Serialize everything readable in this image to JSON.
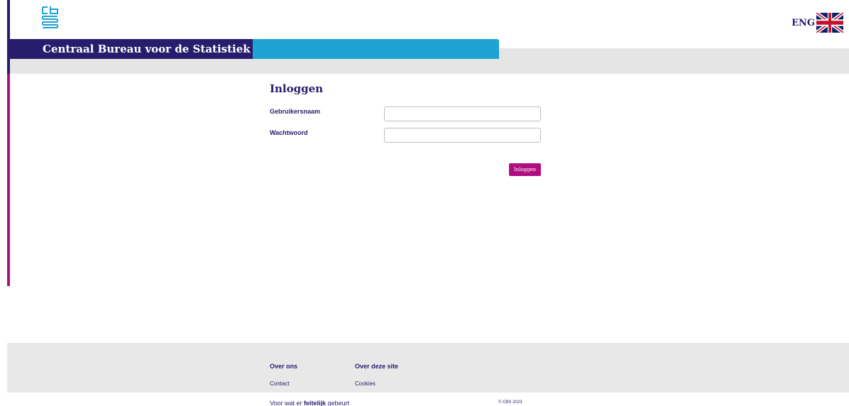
{
  "header": {
    "org_name": "Centraal Bureau voor de Statistiek",
    "language_label": "ENG"
  },
  "login": {
    "title": "Inloggen",
    "username_label": "Gebruikersnaam",
    "username_value": "",
    "password_label": "Wachtwoord",
    "password_value": "",
    "submit_label": "Inloggen"
  },
  "footer": {
    "columns": [
      {
        "heading": "Over ons",
        "links": [
          "Contact"
        ]
      },
      {
        "heading": "Over deze site",
        "links": [
          "Cookies"
        ]
      }
    ],
    "tagline_pre": "Voor wat er ",
    "tagline_bold": "feitelijk",
    "tagline_post": " gebeurt",
    "copyright": "© CBS 2023"
  },
  "colors": {
    "navy": "#271d6c",
    "magenta": "#af0e80",
    "blue": "#1ea2d2",
    "gray": "#e5e5e5"
  }
}
